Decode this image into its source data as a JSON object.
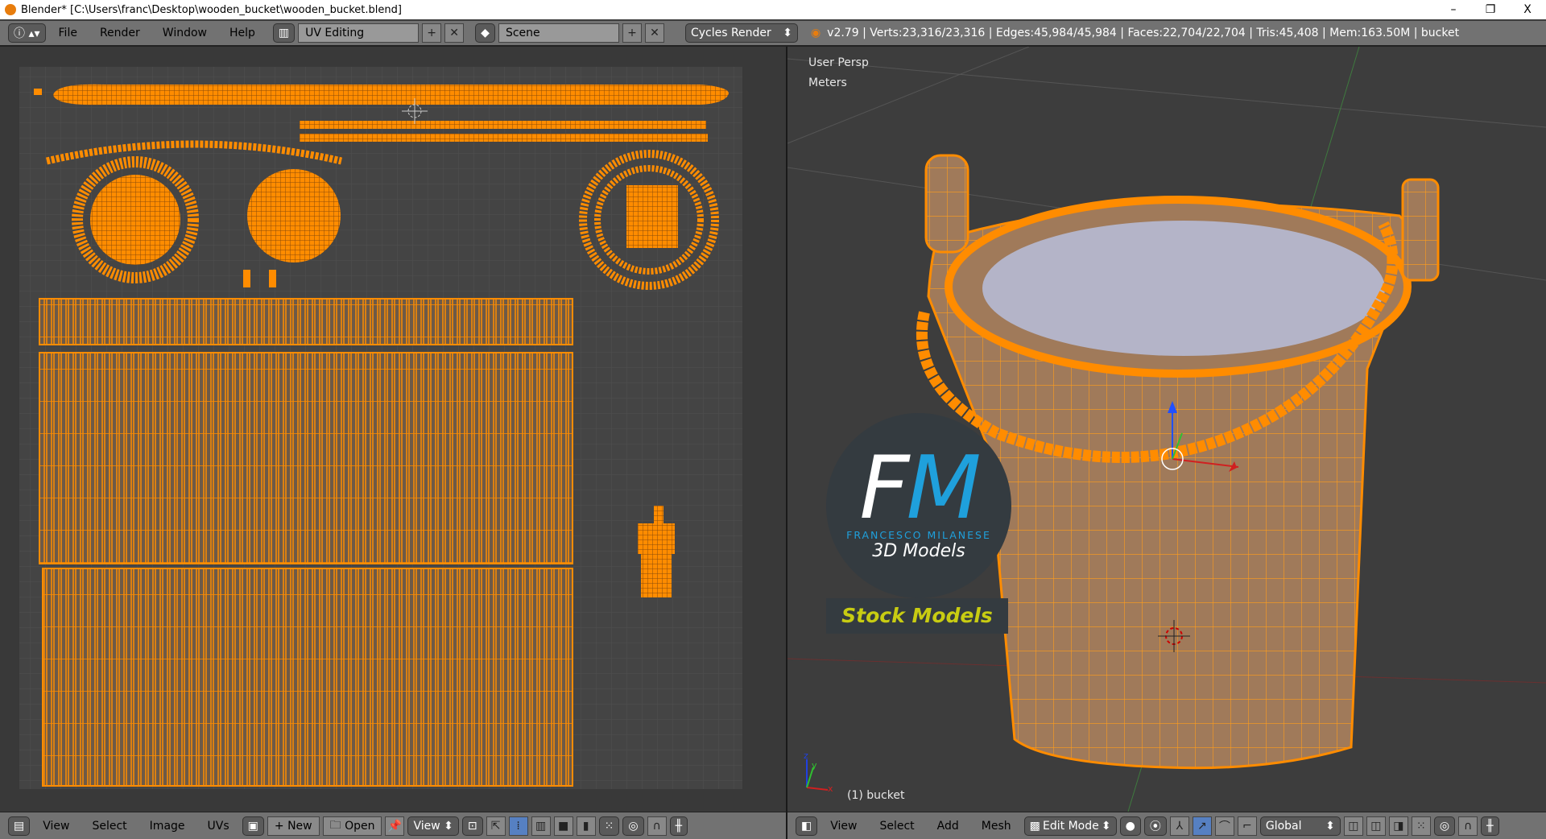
{
  "window": {
    "title": "Blender* [C:\\Users\\franc\\Desktop\\wooden_bucket\\wooden_bucket.blend]",
    "minimize": "–",
    "maximize": "❐",
    "close": "X"
  },
  "topbar": {
    "menus": [
      "File",
      "Render",
      "Window",
      "Help"
    ],
    "layout": "UV Editing",
    "scene": "Scene",
    "engine": "Cycles Render",
    "add": "+",
    "remove": "✕",
    "stats": "v2.79 | Verts:23,316/23,316 | Edges:45,984/45,984 | Faces:22,704/22,704 | Tris:45,408 | Mem:163.50M | bucket"
  },
  "uv_editor": {
    "menus": [
      "View",
      "Select",
      "Image",
      "UVs"
    ],
    "new_label": "New",
    "open_label": "Open",
    "view_label": "View"
  },
  "viewport": {
    "view_name": "User Persp",
    "units": "Meters",
    "object_label": "(1) bucket",
    "menus": [
      "View",
      "Select",
      "Add",
      "Mesh"
    ],
    "mode": "Edit Mode",
    "orientation": "Global",
    "axis_labels": {
      "x": "x",
      "y": "y",
      "z": "z"
    }
  },
  "watermark": {
    "initials_f": "F",
    "initials_m": "M",
    "name": "FRANCESCO MILANESE",
    "subtitle": "3D Models",
    "banner": "Stock Models"
  },
  "colors": {
    "accent": "#ff8c00",
    "uv_bg": "#444444",
    "viewport_bg": "#3d3d3d",
    "header": "#727272",
    "logo_blue": "#1fa0dc",
    "banner_text": "#c8cc12"
  }
}
